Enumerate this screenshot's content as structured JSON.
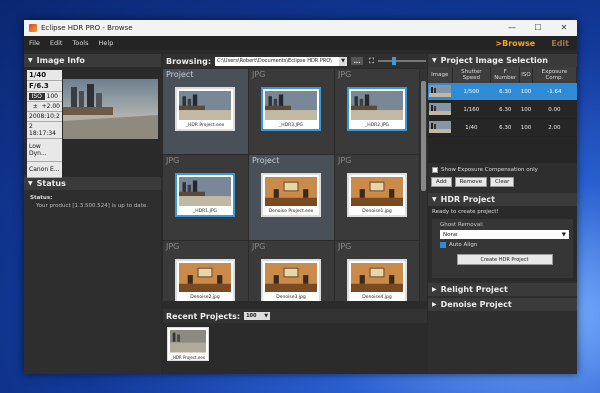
{
  "window": {
    "title": "Eclipse HDR PRO - Browse",
    "controls": {
      "minimize": "—",
      "maximize": "☐",
      "close": "✕"
    }
  },
  "menu": {
    "items": [
      "File",
      "Edit",
      "Tools",
      "Help"
    ],
    "modes": {
      "browse": ">Browse",
      "edit": "Edit"
    }
  },
  "image_info": {
    "heading": "Image Info",
    "exif": {
      "shutter": "1/40",
      "fnumber": "F/6.3",
      "iso_label": "ISO",
      "iso": "100",
      "ev_icon": "±",
      "ev": "+2.00",
      "date": "2008:10:2",
      "time": "2 18:17:34",
      "lens": "Low Dyn...",
      "camera": "Canon E..."
    }
  },
  "status_panel": {
    "heading": "Status",
    "label": "Status:",
    "message": "Your product [1.3.500.524] is up to date."
  },
  "browsing": {
    "label": "Browsing:",
    "path": "C:\\Users\\Robert\\Documents\\Eclipse HDR PRO\\",
    "dots": "...",
    "cells": [
      {
        "tag": "Project",
        "file": "_HDR Project.eex",
        "kind": "city",
        "project": true,
        "selected": false
      },
      {
        "tag": "JPG",
        "file": "_HDR3.JPG",
        "kind": "city",
        "project": false,
        "selected": true
      },
      {
        "tag": "JPG",
        "file": "_HDR2.JPG",
        "kind": "city",
        "project": false,
        "selected": true
      },
      {
        "tag": "JPG",
        "file": "_HDR1.JPG",
        "kind": "city",
        "project": false,
        "selected": true
      },
      {
        "tag": "Project",
        "file": "Denoise Project.eex",
        "kind": "room",
        "project": true,
        "selected": false
      },
      {
        "tag": "JPG",
        "file": "Denoise1.jpg",
        "kind": "room",
        "project": false,
        "selected": false
      },
      {
        "tag": "JPG",
        "file": "Denoise2.jpg",
        "kind": "room",
        "project": false,
        "selected": false
      },
      {
        "tag": "JPG",
        "file": "Denoise3.jpg",
        "kind": "room",
        "project": false,
        "selected": false
      },
      {
        "tag": "JPG",
        "file": "Denoise4.jpg",
        "kind": "room",
        "project": false,
        "selected": false
      }
    ]
  },
  "recent": {
    "label": "Recent Projects:",
    "count": "100",
    "items": [
      {
        "file": "_HDR Project.eex"
      }
    ]
  },
  "selection": {
    "heading": "Project Image Selection",
    "columns": [
      "Image",
      "Shutter Speed",
      "F Number",
      "ISO",
      "Exposure Comp."
    ],
    "rows": [
      {
        "shutter": "1/500",
        "f": "6.30",
        "iso": "100",
        "ev": "-1.64",
        "selected": true
      },
      {
        "shutter": "1/160",
        "f": "6.30",
        "iso": "100",
        "ev": "0.00",
        "selected": false
      },
      {
        "shutter": "1/40",
        "f": "6.30",
        "iso": "100",
        "ev": "2.00",
        "selected": false
      }
    ],
    "show_ev_label": "Show Exposure Compensation only",
    "buttons": {
      "add": "Add",
      "remove": "Remove",
      "clear": "Clear"
    }
  },
  "hdr_project": {
    "heading": "HDR Project",
    "ready": "Ready to create project!",
    "ghost_label": "Ghost Removal:",
    "ghost_value": "None",
    "auto_align": "Auto Align",
    "create": "Create HDR Project"
  },
  "relight": {
    "heading": "Relight Project"
  },
  "denoise": {
    "heading": "Denoise Project"
  },
  "colors": {
    "accent": "#f5a623",
    "selection": "#2f8bd6"
  }
}
